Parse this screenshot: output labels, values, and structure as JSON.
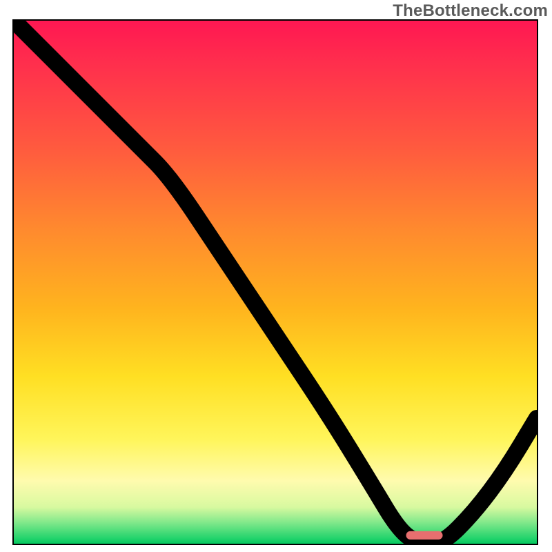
{
  "watermark": "TheBottleneck.com",
  "chart_data": {
    "type": "line",
    "title": "",
    "xlabel": "",
    "ylabel": "",
    "xlim": [
      0,
      100
    ],
    "ylim": [
      0,
      100
    ],
    "legend": null,
    "grid": false,
    "series": [
      {
        "name": "bottleneck-curve",
        "x": [
          0,
          12,
          24,
          30,
          40,
          50,
          60,
          68,
          74,
          78,
          82,
          88,
          94,
          100
        ],
        "values": [
          100,
          88,
          76,
          70,
          55,
          40,
          25,
          12,
          2,
          0,
          0,
          6,
          14,
          24
        ]
      }
    ],
    "annotations": [
      {
        "name": "recommended-marker",
        "x_range": [
          75,
          82
        ],
        "y": 0.8,
        "color": "#e76f6f"
      }
    ],
    "background_gradient": {
      "type": "vertical",
      "stops": [
        [
          "#ff1752",
          0
        ],
        [
          "#ff8a2e",
          40
        ],
        [
          "#ffdf23",
          68
        ],
        [
          "#fffbae",
          88
        ],
        [
          "#04c95f",
          100
        ]
      ],
      "meaning": "high value = worse (red), low value = better (green)"
    }
  }
}
